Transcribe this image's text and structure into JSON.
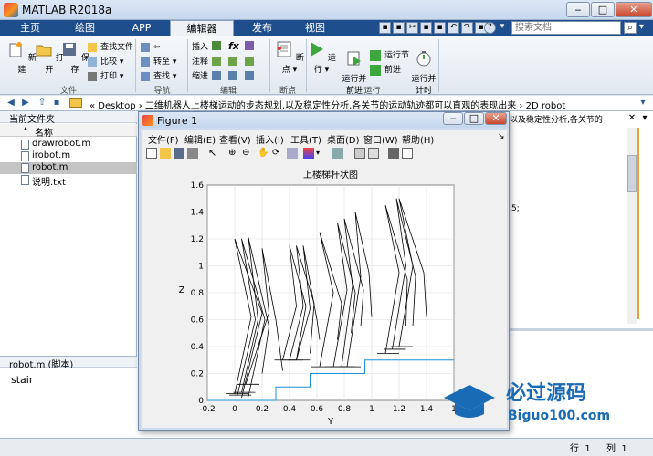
{
  "app": {
    "title": "MATLAB R2018a"
  },
  "ribbon_tabs": [
    "主页",
    "绘图",
    "APP",
    "编辑器",
    "发布",
    "视图"
  ],
  "search": {
    "placeholder": "搜索文档"
  },
  "ribbon": {
    "file_group": {
      "label": "文件",
      "new": "新建",
      "open": "打开",
      "save": "保存",
      "find_files": "查找文件",
      "compare": "比较",
      "print": "打印"
    },
    "nav_group": {
      "label": "导航",
      "goto": "转至",
      "find": "查找"
    },
    "edit_group": {
      "label": "编辑",
      "insert": "插入",
      "comment": "注释",
      "indent": "缩进",
      "fx": "fx"
    },
    "breakpoint_group": {
      "label": "断点",
      "breakpoints": "断点"
    },
    "run_group": {
      "label": "运行",
      "run": "运行",
      "run_and_advance": "运行并\n前进",
      "run_section": "运行节",
      "advance": "前进",
      "run_and_time": "运行并\n计时"
    }
  },
  "address": {
    "path": "« Desktop › 二维机器人上楼梯运动的步态规划,以及稳定性分析,各关节的运动轨迹都可以直观的表现出来 › 2D robot"
  },
  "current_folder": {
    "title": "当前文件夹",
    "column_name": "名称",
    "files": [
      {
        "name": "drawrobot.m",
        "selected": false
      },
      {
        "name": "irobot.m",
        "selected": false
      },
      {
        "name": "robot.m",
        "selected": true
      },
      {
        "name": "说明.txt",
        "selected": false
      }
    ]
  },
  "details": {
    "title": "robot.m  (脚本)",
    "content": "stair"
  },
  "background_editor": {
    "partial_text": "以及稳定性分析,各关节的",
    "partial_code": "5;"
  },
  "status": {
    "row_label": "行",
    "row_value": "1",
    "col_label": "列",
    "col_value": "1"
  },
  "figure": {
    "title": "Figure 1",
    "menus": [
      "文件(F)",
      "编辑(E)",
      "查看(V)",
      "插入(I)",
      "工具(T)",
      "桌面(D)",
      "窗口(W)",
      "帮助(H)"
    ]
  },
  "watermark": {
    "cn": "必过源码",
    "en": "Biguo100.com"
  },
  "chart_data": {
    "type": "line",
    "title": "上楼梯杆状图",
    "xlabel": "Y",
    "ylabel": "Z",
    "xlim": [
      -0.2,
      1.6
    ],
    "ylim": [
      0,
      1.6
    ],
    "xticks": [
      -0.2,
      0,
      0.2,
      0.4,
      0.6,
      0.8,
      1,
      1.2,
      1.4,
      1.6
    ],
    "xtick_labels": [
      "-0.2",
      "0",
      "0.2",
      "0.4",
      "0.6",
      "0.8",
      "1",
      "1.2",
      "1.4",
      "1"
    ],
    "yticks": [
      0,
      0.2,
      0.4,
      0.6,
      0.8,
      1,
      1.2,
      1.4,
      1.6
    ],
    "ytick_labels": [
      "0",
      "0.2",
      "0.4",
      "0.6",
      "0.8",
      "1",
      "1.2",
      "1.4",
      "1.6"
    ],
    "grid": true,
    "stair_color": "#1f8fd8",
    "stair": {
      "x": [
        -0.2,
        0.3,
        0.3,
        0.55,
        0.55,
        0.7,
        0.7,
        0.95,
        0.95,
        1.1,
        1.1,
        1.6
      ],
      "y": [
        0,
        0,
        0.1,
        0.1,
        0.2,
        0.2,
        0.2,
        0.2,
        0.3,
        0.3,
        0.3,
        0.3
      ]
    },
    "stick_color": "#000000",
    "sticks": [
      {
        "hip": [
          0.0,
          1.2
        ],
        "kneeL": [
          0.12,
          0.62
        ],
        "footL": [
          0.0,
          0.05
        ],
        "kneeR": [
          0.2,
          0.65
        ],
        "footR": [
          0.05,
          0.02
        ]
      },
      {
        "hip": [
          0.05,
          1.2
        ],
        "kneeL": [
          0.15,
          0.6
        ],
        "footL": [
          0.02,
          0.04
        ],
        "kneeR": [
          0.22,
          0.6
        ],
        "footR": [
          0.1,
          0.03
        ]
      },
      {
        "hip": [
          0.1,
          1.21
        ],
        "kneeL": [
          0.17,
          0.6
        ],
        "footL": [
          0.05,
          0.06
        ],
        "kneeR": [
          0.25,
          0.55
        ],
        "footR": [
          0.2,
          0.2
        ]
      },
      {
        "hip": [
          0.2,
          1.13
        ],
        "kneeL": [
          0.25,
          0.65
        ],
        "footL": [
          0.08,
          0.12
        ],
        "kneeR": [
          0.3,
          0.6
        ],
        "footR": [
          0.35,
          0.22
        ]
      },
      {
        "hip": [
          0.4,
          1.15
        ],
        "kneeL": [
          0.45,
          0.7
        ],
        "footL": [
          0.35,
          0.3
        ],
        "kneeR": [
          0.52,
          0.7
        ],
        "footR": [
          0.45,
          0.3
        ]
      },
      {
        "hip": [
          0.45,
          1.15
        ],
        "kneeL": [
          0.5,
          0.7
        ],
        "footL": [
          0.4,
          0.3
        ],
        "kneeR": [
          0.58,
          0.72
        ],
        "footR": [
          0.55,
          0.35
        ]
      },
      {
        "hip": [
          0.5,
          1.15
        ],
        "kneeL": [
          0.55,
          0.68
        ],
        "footL": [
          0.45,
          0.3
        ],
        "kneeR": [
          0.6,
          0.6
        ],
        "footR": [
          0.62,
          0.45
        ]
      },
      {
        "hip": [
          0.62,
          1.25
        ],
        "kneeL": [
          0.72,
          0.8
        ],
        "footL": [
          0.62,
          0.25
        ],
        "kneeR": [
          0.78,
          0.72
        ],
        "footR": [
          0.75,
          0.45
        ]
      },
      {
        "hip": [
          0.75,
          1.32
        ],
        "kneeL": [
          0.82,
          0.82
        ],
        "footL": [
          0.72,
          0.25
        ],
        "kneeR": [
          0.88,
          0.8
        ],
        "footR": [
          0.85,
          0.5
        ]
      },
      {
        "hip": [
          0.8,
          1.35
        ],
        "kneeL": [
          0.86,
          0.85
        ],
        "footL": [
          0.78,
          0.25
        ],
        "kneeR": [
          0.94,
          0.82
        ],
        "footR": [
          0.92,
          0.55
        ]
      },
      {
        "hip": [
          0.88,
          1.4
        ],
        "kneeL": [
          0.92,
          0.92
        ],
        "footL": [
          0.82,
          0.25
        ],
        "kneeR": [
          0.98,
          0.95
        ],
        "footR": [
          1.0,
          0.62
        ]
      },
      {
        "hip": [
          1.1,
          1.45
        ],
        "kneeL": [
          1.2,
          0.95
        ],
        "footL": [
          1.1,
          0.35
        ],
        "kneeR": [
          1.26,
          0.9
        ],
        "footR": [
          1.25,
          0.55
        ]
      },
      {
        "hip": [
          1.18,
          1.5
        ],
        "kneeL": [
          1.25,
          1.0
        ],
        "footL": [
          1.15,
          0.38
        ],
        "kneeR": [
          1.32,
          0.92
        ],
        "footR": [
          1.3,
          0.55
        ]
      },
      {
        "hip": [
          1.2,
          1.5
        ],
        "kneeL": [
          1.3,
          1.0
        ],
        "footL": [
          1.2,
          0.4
        ],
        "kneeR": [
          1.38,
          0.95
        ],
        "footR": [
          1.4,
          0.62
        ]
      }
    ]
  }
}
